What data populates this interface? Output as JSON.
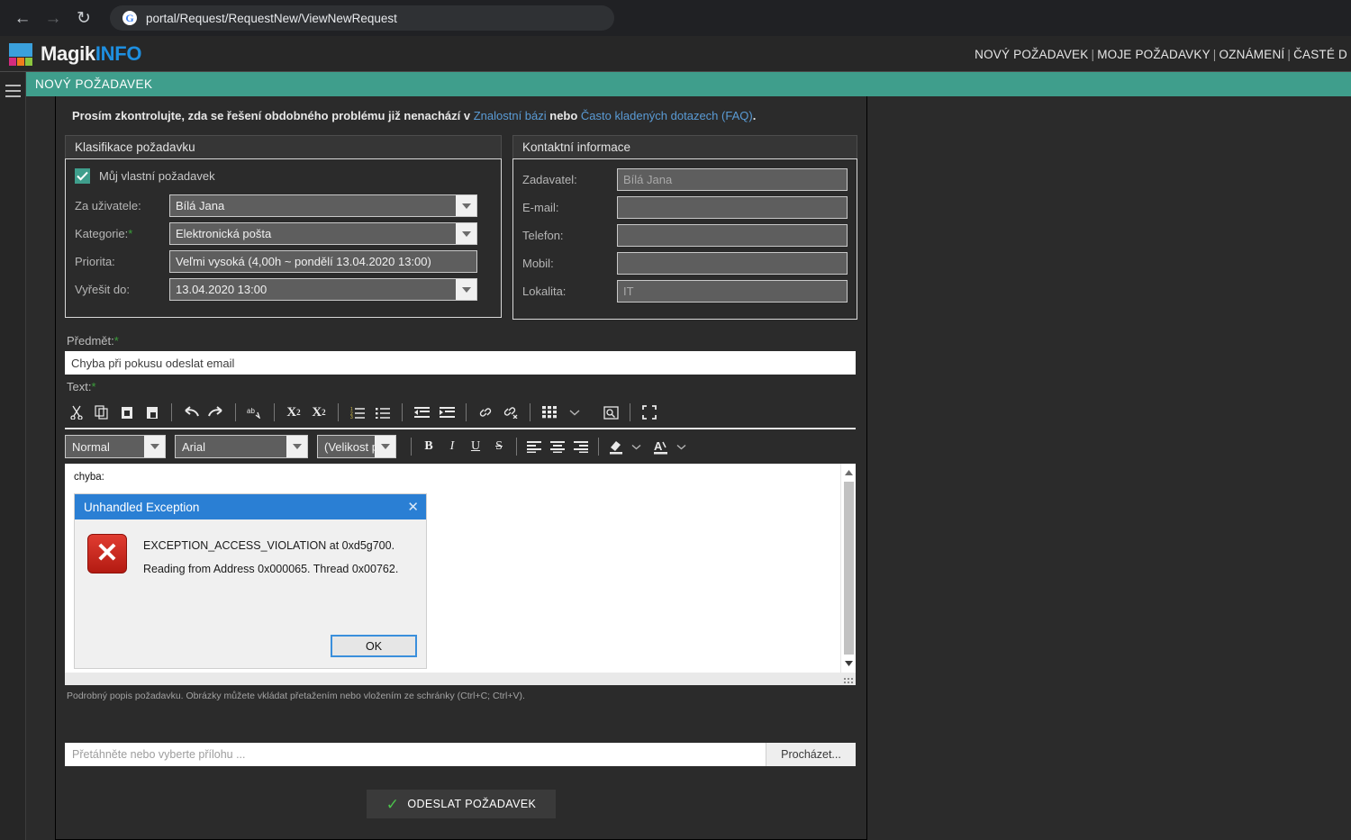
{
  "browser": {
    "back_icon": "arrow-left-icon",
    "forward_icon": "arrow-right-icon",
    "reload_icon": "reload-icon",
    "site_icon_letter": "G",
    "url": "portal/Request/RequestNew/ViewNewRequest"
  },
  "app": {
    "logo_text_light": "Magik",
    "logo_text_accent": "INFO",
    "accent_color": "#1e8fe0",
    "teal_color": "#3f9e8c",
    "nav_items": [
      "NOVÝ POŽADAVEK",
      "MOJE POŽADAVKY",
      "OZNÁMENÍ",
      "ČASTÉ D"
    ],
    "menu_icon": "hamburger-icon"
  },
  "page": {
    "title": "NOVÝ POŽADAVEK",
    "notice_prefix": "Prosím zkontrolujte, zda se řešení obdobného problému již nenachází v ",
    "notice_link1": "Znalostní bázi",
    "notice_middle": " nebo ",
    "notice_link2": "Často kladených dotazech (FAQ)",
    "notice_suffix": "."
  },
  "classification": {
    "title": "Klasifikace požadavku",
    "checkbox_label": "Můj vlastní požadavek",
    "checkbox_checked": true,
    "fields": [
      {
        "label": "Za uživatele:",
        "value": "Bílá Jana",
        "type": "select"
      },
      {
        "label": "Kategorie:",
        "required": "*",
        "value": "Elektronická pošta",
        "type": "select"
      },
      {
        "label": "Priorita:",
        "value": "Veľmi vysoká (4,00h ~ pondělí 13.04.2020 13:00)",
        "type": "readonly"
      },
      {
        "label": "Vyřešit do:",
        "value": "13.04.2020 13:00",
        "type": "select"
      }
    ]
  },
  "contact": {
    "title": "Kontaktní informace",
    "fields": [
      {
        "label": "Zadavatel:",
        "value": "Bílá Jana"
      },
      {
        "label": "E-mail:",
        "value": ""
      },
      {
        "label": "Telefon:",
        "value": ""
      },
      {
        "label": "Mobil:",
        "value": ""
      },
      {
        "label": "Lokalita:",
        "value": "IT"
      }
    ]
  },
  "subject": {
    "label": "Předmět:",
    "required": "*",
    "value": "Chyba při pokusu odeslat email"
  },
  "text_editor": {
    "label": "Text:",
    "required": "*",
    "toolbar_row1": [
      "cut-icon",
      "copy-icon",
      "paste-icon",
      "paste-text-icon",
      "undo-icon",
      "redo-icon",
      "spellcheck-icon",
      "superscript-icon",
      "subscript-icon",
      "numbered-list-icon",
      "bulleted-list-icon",
      "outdent-icon",
      "indent-icon",
      "link-icon",
      "unlink-icon",
      "table-icon",
      "table-dropdown-icon",
      "image-icon",
      "fullscreen-icon"
    ],
    "paragraph_format": "Normal",
    "font_family": "Arial",
    "font_size": "(Velikost p",
    "bold_label": "B",
    "italic_label": "I",
    "underline_label": "U",
    "strike_label": "S",
    "align_icons": [
      "align-left-icon",
      "align-center-icon",
      "align-right-icon"
    ],
    "color_icons": [
      "highlight-color-icon",
      "text-color-icon"
    ],
    "content_text": "chyba:",
    "hint": "Podrobný popis požadavku. Obrázky můžete vkládat přetažením nebo vložením ze schránky (Ctrl+C; Ctrl+V)."
  },
  "error_dialog": {
    "title": "Unhandled Exception",
    "close_icon": "close-icon",
    "error_icon": "error-cross-icon",
    "line1": "EXCEPTION_ACCESS_VIOLATION at 0xd5g700.",
    "line2": "Reading from Address 0x000065. Thread 0x00762.",
    "ok_label": "OK"
  },
  "attachment": {
    "placeholder": "Přetáhněte nebo vyberte přílohu ...",
    "browse_label": "Procházet..."
  },
  "submit": {
    "label": "ODESLAT POŽADAVEK",
    "icon": "check-icon",
    "icon_color": "#4cc24c"
  }
}
